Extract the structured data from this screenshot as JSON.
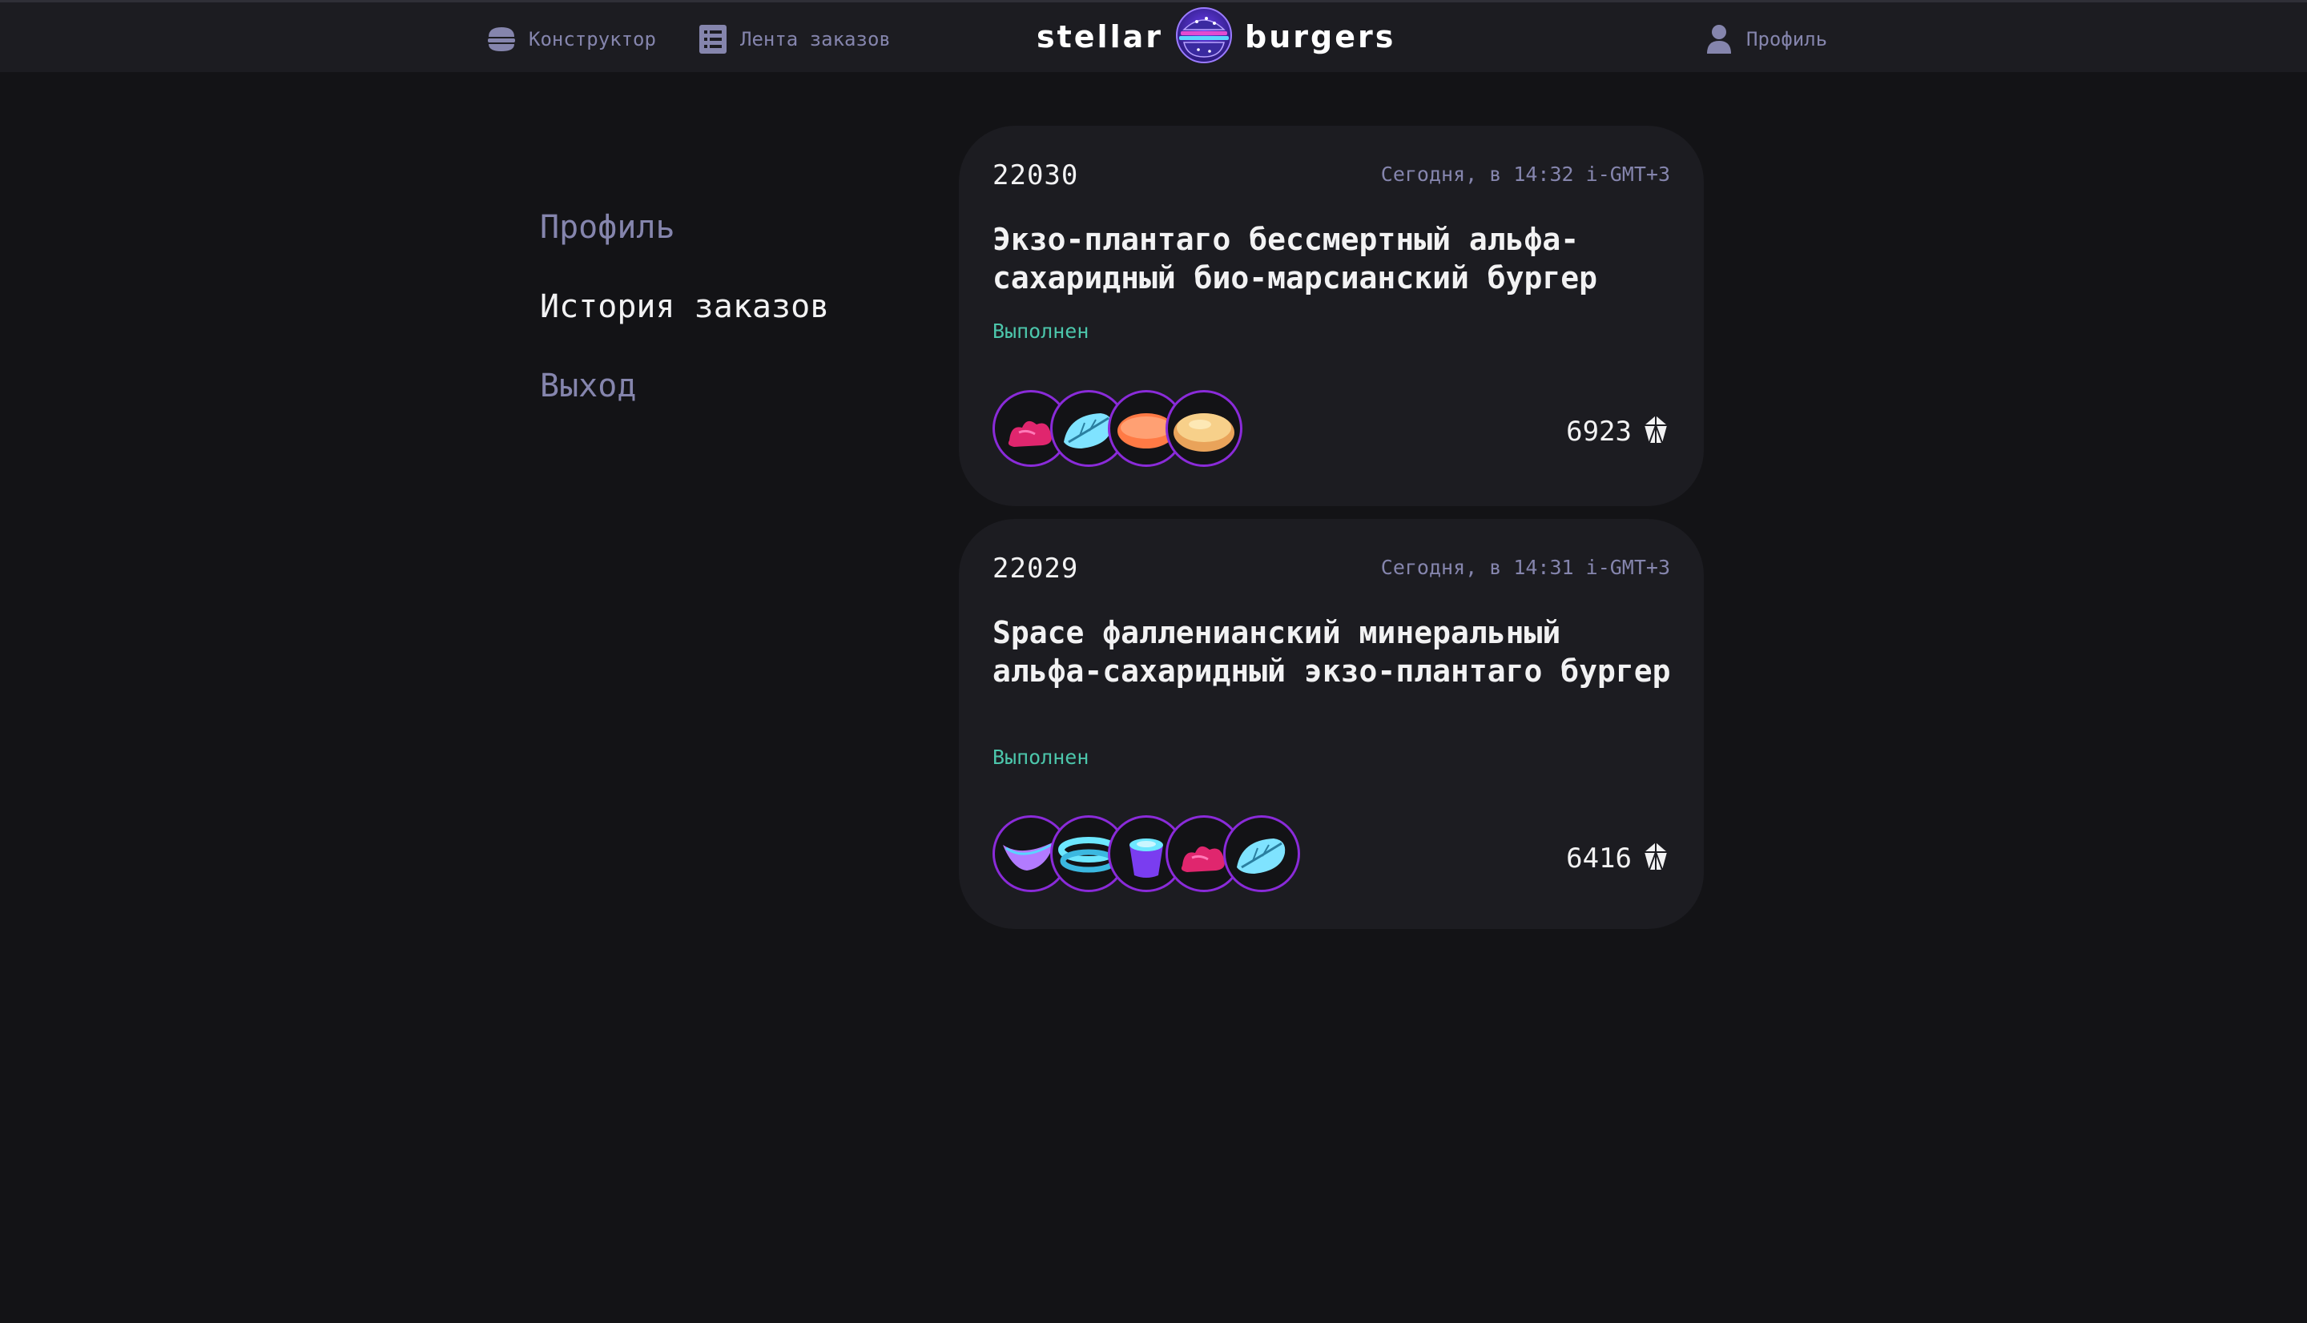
{
  "header": {
    "nav": {
      "constructor_label": "Конструктор",
      "feed_label": "Лента заказов",
      "profile_label": "Профиль"
    },
    "logo": {
      "left_word": "stellar",
      "right_word": "burgers"
    }
  },
  "sidebar": {
    "items": [
      {
        "label": "Профиль",
        "active": false
      },
      {
        "label": "История заказов",
        "active": true
      },
      {
        "label": "Выход",
        "active": false
      }
    ]
  },
  "orders": [
    {
      "number": "22030",
      "date": "Сегодня, в 14:32 i-GMT+3",
      "name": "Экзо-плантаго бессмертный альфа-сахаридный био-марсианский бургер",
      "status": "Выполнен",
      "price": "6923",
      "ingredient_icons": [
        "meat-icon",
        "leaf-icon",
        "cutlet-icon",
        "bun-icon"
      ]
    },
    {
      "number": "22029",
      "date": "Сегодня, в 14:31 i-GMT+3",
      "name": "Space фалленианский минеральный альфа-сахаридный экзо-плантаго бургер",
      "status": "Выполнен",
      "price": "6416",
      "ingredient_icons": [
        "fin-icon",
        "rings-icon",
        "sauce-icon",
        "meat-icon",
        "leaf-icon"
      ]
    }
  ],
  "colors": {
    "background": "#131316",
    "panel": "#1c1c21",
    "muted_text": "#8585ad",
    "status_done": "#4cc6ab",
    "ingredient_border": "#8a2bd9"
  }
}
